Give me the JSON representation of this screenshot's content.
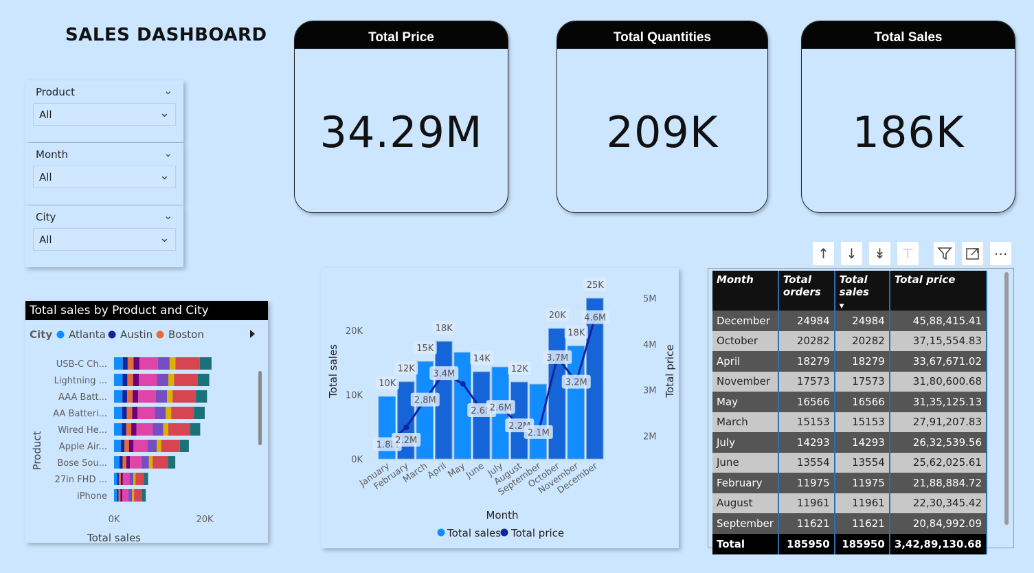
{
  "title": "SALES DASHBOARD",
  "slicers": [
    {
      "label": "Product",
      "value": "All"
    },
    {
      "label": "Month",
      "value": "All"
    },
    {
      "label": "City",
      "value": "All"
    }
  ],
  "kpis": [
    {
      "label": "Total Price",
      "value": "34.29M"
    },
    {
      "label": "Total Quantities",
      "value": "209K"
    },
    {
      "label": "Total Sales",
      "value": "186K"
    }
  ],
  "bar_panel": {
    "title": "Total sales by Product and City",
    "legend_title": "City",
    "legend": [
      {
        "name": "Atlanta",
        "color": "#118DFF"
      },
      {
        "name": "Austin",
        "color": "#12239E"
      },
      {
        "name": "Boston",
        "color": "#E66C37"
      }
    ]
  },
  "combo_panel": {
    "legend": [
      {
        "name": "Total sales",
        "color": "#118DFF"
      },
      {
        "name": "Total price",
        "color": "#12239E"
      }
    ]
  },
  "table": {
    "headers": [
      "Month",
      "Total orders",
      "Total sales",
      "Total price"
    ],
    "rows": [
      [
        "December",
        "24984",
        "24984",
        "45,88,415.41"
      ],
      [
        "October",
        "20282",
        "20282",
        "37,15,554.83"
      ],
      [
        "April",
        "18279",
        "18279",
        "33,67,671.02"
      ],
      [
        "November",
        "17573",
        "17573",
        "31,80,600.68"
      ],
      [
        "May",
        "16566",
        "16566",
        "31,35,125.13"
      ],
      [
        "March",
        "15153",
        "15153",
        "27,91,207.83"
      ],
      [
        "July",
        "14293",
        "14293",
        "26,32,539.56"
      ],
      [
        "June",
        "13554",
        "13554",
        "25,62,025.61"
      ],
      [
        "February",
        "11975",
        "11975",
        "21,88,884.72"
      ],
      [
        "August",
        "11961",
        "11961",
        "22,30,345.42"
      ],
      [
        "September",
        "11621",
        "11621",
        "20,84,992.09"
      ]
    ],
    "total": [
      "Total",
      "185950",
      "185950",
      "3,42,89,130.68"
    ]
  },
  "chart_data": [
    {
      "type": "bar",
      "orientation": "horizontal-stacked",
      "title": "Total sales by Product and City",
      "xlabel": "Total sales",
      "ylabel": "Product",
      "xlim": [
        0,
        20000
      ],
      "xticks": [
        "0K",
        "20K"
      ],
      "categories": [
        "USB-C Ch...",
        "Lightning ...",
        "AAA Batt...",
        "AA Batteri...",
        "Wired He...",
        "Apple Air...",
        "Bose Sou...",
        "27in FHD ...",
        "iPhone"
      ],
      "totals": [
        21500,
        21000,
        20500,
        20000,
        19000,
        16500,
        13500,
        7500,
        7000
      ],
      "segment_colors": [
        "#118DFF",
        "#12239E",
        "#E66C37",
        "#6B007B",
        "#E044A7",
        "#744EC2",
        "#D9B300",
        "#D64550",
        "#197278"
      ]
    },
    {
      "type": "bar+line",
      "xlabel": "Month",
      "ylabel": "Total sales",
      "y2label": "Total price",
      "categories": [
        "January",
        "February",
        "March",
        "April",
        "May",
        "June",
        "July",
        "August",
        "September",
        "October",
        "November",
        "December"
      ],
      "ylim": [
        0,
        25000
      ],
      "yticks": [
        "0K",
        "10K",
        "20K"
      ],
      "y2lim": [
        1500000,
        5000000
      ],
      "y2ticks": [
        "2M",
        "3M",
        "4M",
        "5M"
      ],
      "series": [
        {
          "name": "Total sales",
          "values": [
            9700,
            12000,
            15153,
            18279,
            16566,
            13554,
            14293,
            11961,
            11621,
            20282,
            17573,
            24984
          ],
          "labels": [
            "10K",
            "12K",
            "15K",
            "18K",
            "",
            "14K",
            "",
            "12K",
            "",
            "20K",
            "18K",
            "25K"
          ]
        },
        {
          "name": "Total price",
          "values": [
            1822000,
            2188884,
            2791207,
            3367671,
            3135125,
            2562025,
            2632539,
            2230345,
            2084992,
            3715554,
            3180600,
            4588415
          ],
          "labels": [
            "1.8M",
            "2.2M",
            "2.8M",
            "3.4M",
            "",
            "2.6M",
            "2.6M",
            "2.2M",
            "2.1M",
            "3.7M",
            "3.2M",
            "4.6M"
          ]
        }
      ]
    }
  ]
}
